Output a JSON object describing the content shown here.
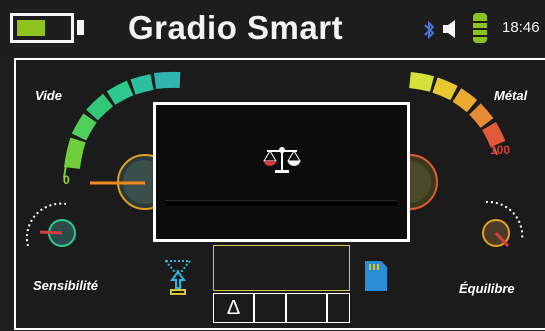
{
  "header": {
    "title": "Gradio Smart",
    "time": "18:46",
    "battery_level": 0.55
  },
  "icons": {
    "battery": "battery-icon",
    "bluetooth": "bluetooth-icon",
    "speaker": "speaker-icon",
    "signal": "signal-level-icon",
    "balance": "balance-scale-icon",
    "upload": "upload-arrow-icon",
    "sd_card": "sd-card-icon"
  },
  "gauges": {
    "left_label": "Vide",
    "left_value": "0",
    "right_label": "Métal",
    "right_value": "100",
    "sensitivity_label": "Sensibilité",
    "balance_label": "Équilibre"
  },
  "bottom": {
    "delta": "Δ"
  },
  "colors": {
    "accent_green": "#8dc21f",
    "meter_green": "#2ec98f",
    "meter_red": "#d63c3c",
    "yellow": "#d7c53a"
  }
}
